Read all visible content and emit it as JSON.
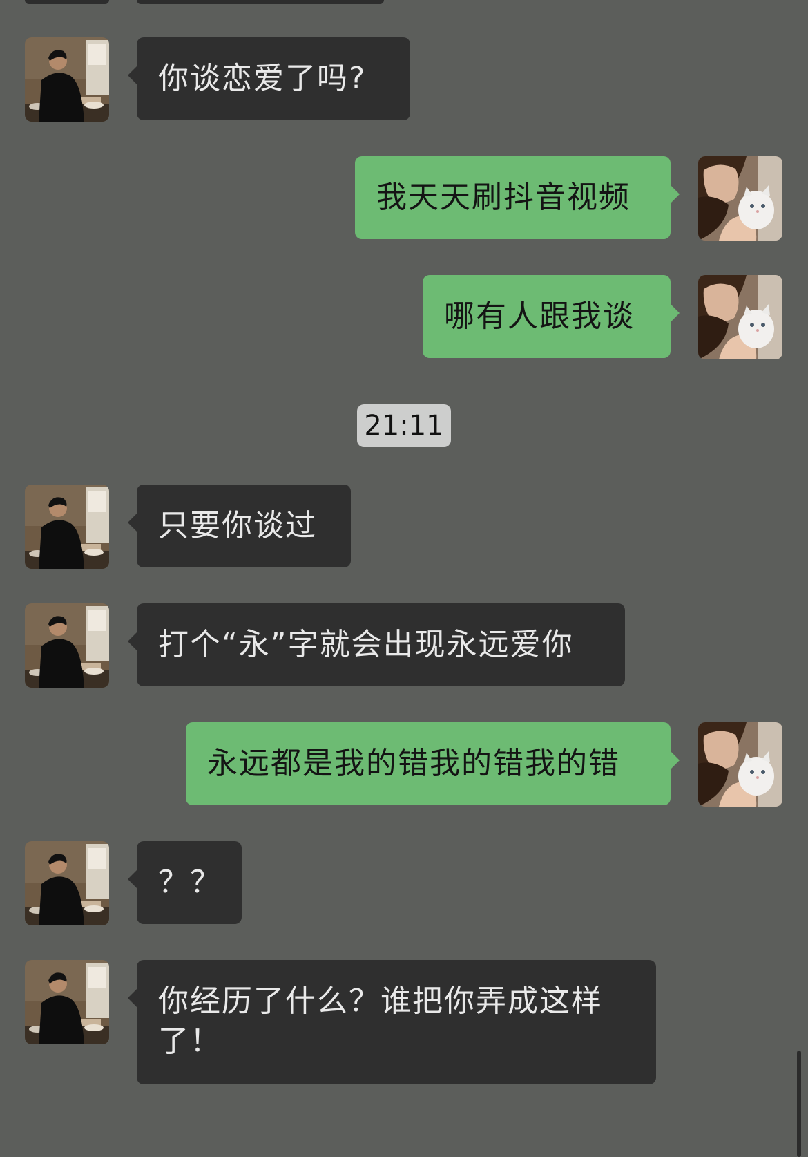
{
  "messages": [
    {
      "sender": "contact",
      "text": "你谈恋爱了吗?"
    },
    {
      "sender": "me",
      "text": "我天天刷抖音视频"
    },
    {
      "sender": "me",
      "text": "哪有人跟我谈"
    },
    {
      "sender": "contact",
      "text": "只要你谈过"
    },
    {
      "sender": "contact",
      "text": "打个“永”字就会出现永远爱你"
    },
    {
      "sender": "me",
      "text": "永远都是我的错我的错我的错"
    },
    {
      "sender": "contact",
      "text": "？？"
    },
    {
      "sender": "contact",
      "text": "你经历了什么？谁把你弄成这样",
      "text_line2": "了！"
    }
  ],
  "timestamp": "21:11",
  "colors": {
    "background": "#5c5e5b",
    "incoming_bubble": "#2f2f2f",
    "outgoing_bubble": "#6dbb73",
    "timestamp_chip": "#cdcecd"
  },
  "icons": {
    "contact_avatar": "man-photo-avatar",
    "my_avatar": "woman-with-cat-avatar"
  }
}
